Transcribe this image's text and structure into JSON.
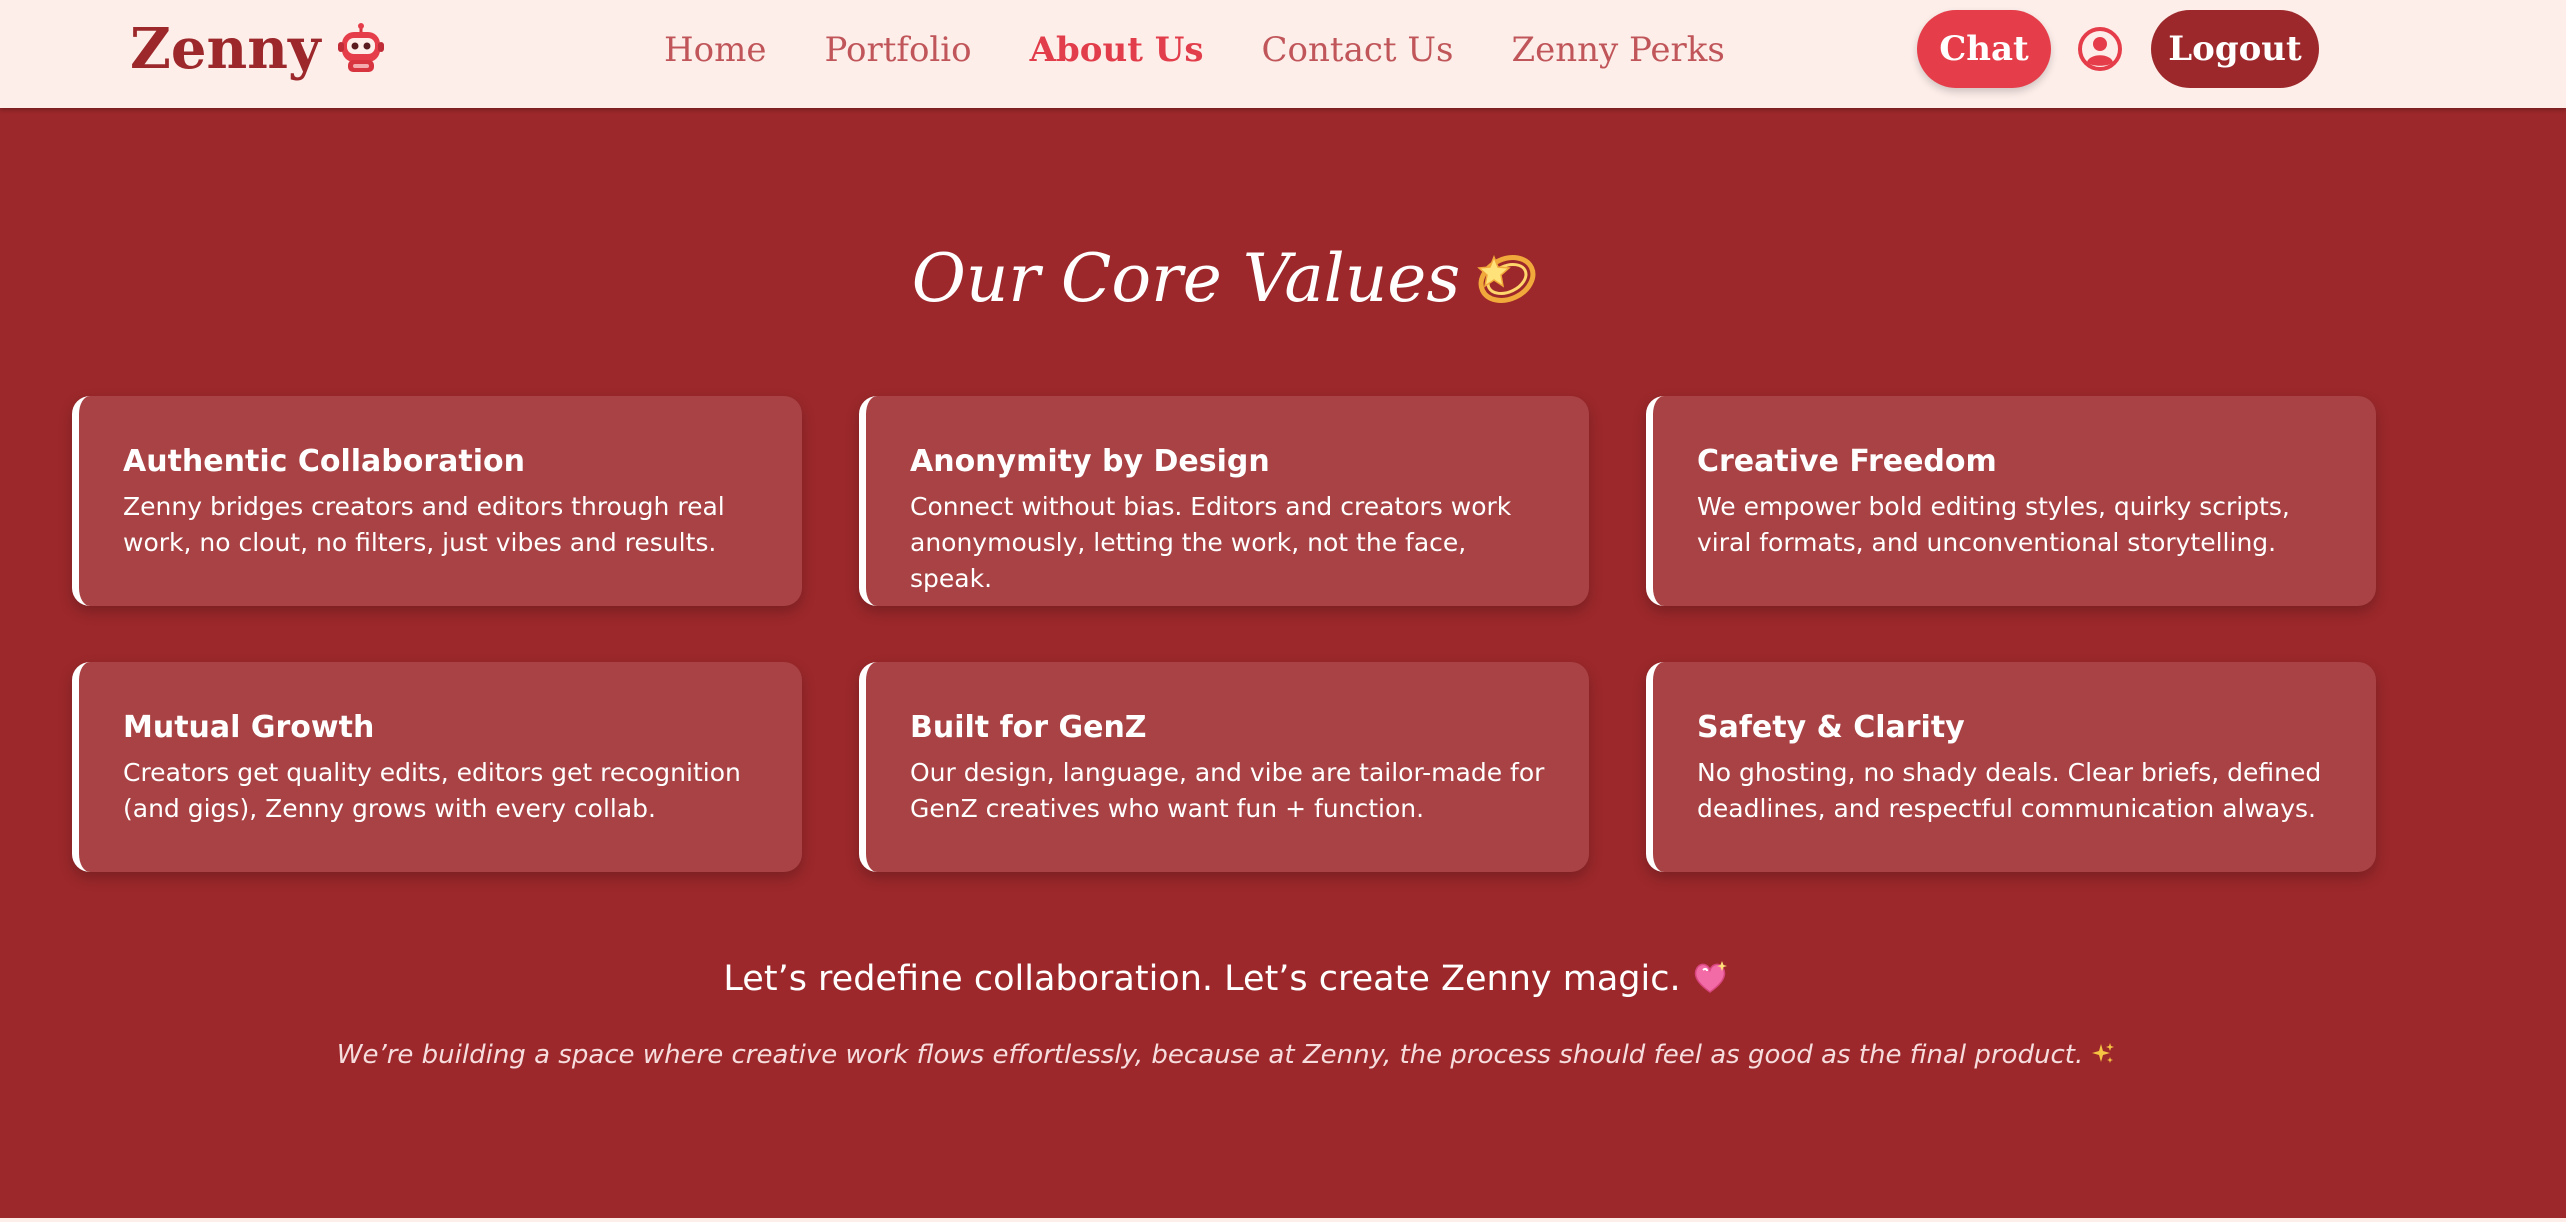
{
  "header": {
    "brand": "Zenny",
    "brand_icon": "robot-mascot-icon",
    "nav": [
      {
        "label": "Home",
        "active": false
      },
      {
        "label": "Portfolio",
        "active": false
      },
      {
        "label": "About Us",
        "active": true
      },
      {
        "label": "Contact Us",
        "active": false
      },
      {
        "label": "Zenny Perks",
        "active": false
      }
    ],
    "chat_label": "Chat",
    "profile_icon": "user-circle-icon",
    "logout_label": "Logout"
  },
  "main": {
    "title": "Our Core Values",
    "title_icon": "dizzy-star-icon",
    "values": [
      {
        "title": "Authentic Collaboration",
        "text": "Zenny bridges creators and editors through real work, no clout, no filters, just vibes and results."
      },
      {
        "title": "Anonymity by Design",
        "text": "Connect without bias. Editors and creators work anonymously, letting the work, not the face, speak."
      },
      {
        "title": "Creative Freedom",
        "text": "We empower bold editing styles, quirky scripts, viral formats, and unconventional storytelling."
      },
      {
        "title": "Mutual Growth",
        "text": "Creators get quality edits, editors get recognition (and gigs), Zenny grows with every collab."
      },
      {
        "title": "Built for GenZ",
        "text": "Our design, language, and vibe are tailor-made for GenZ creatives who want fun + function."
      },
      {
        "title": "Safety & Clarity",
        "text": "No ghosting, no shady deals. Clear briefs, defined deadlines, and respectful communication always."
      }
    ],
    "tagline": "Let’s redefine collaboration. Let’s create Zenny magic.",
    "tagline_icon": "sparkling-heart-icon",
    "subtext": "We’re building a space where creative work flows effortlessly, because at Zenny, the process should feel as good as the final product.",
    "subtext_icon": "sparkles-icon"
  },
  "colors": {
    "background": "#9c282b",
    "header_bg": "#fdeeea",
    "card_bg": "#a84244",
    "chat_button": "#e53e4a",
    "logout_button": "#9c282b",
    "nav_text": "#c0565a",
    "nav_active": "#e23d4a"
  }
}
